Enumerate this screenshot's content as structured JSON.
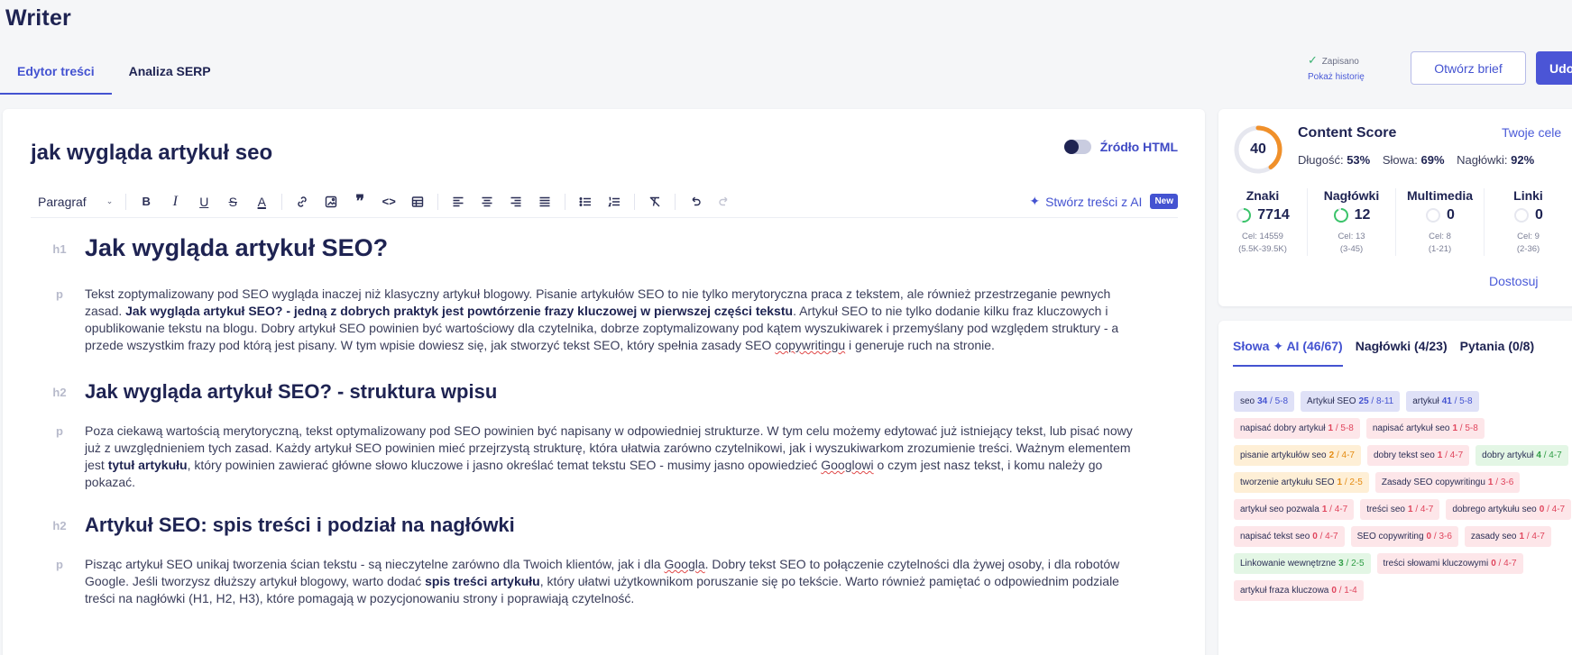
{
  "app": {
    "title": "Writer"
  },
  "tabs": [
    {
      "label": "Edytor treści",
      "active": true
    },
    {
      "label": "Analiza SERP",
      "active": false
    }
  ],
  "header": {
    "saved_label": "Zapisano",
    "history_label": "Pokaż historię",
    "brief_button": "Otwórz brief",
    "share_button": "Udostępnij"
  },
  "editor": {
    "title": "jak wygląda artykuł seo",
    "html_source_label": "Źródło HTML",
    "html_source_enabled": false,
    "toolbar": {
      "paragraph_select": "Paragraf",
      "ai_button": "Stwórz treści z AI",
      "ai_badge": "New"
    },
    "blocks": [
      {
        "tag": "h1",
        "text": "Jak wygląda artykuł SEO?"
      },
      {
        "tag": "p",
        "parts": [
          "Tekst zoptymalizowany pod SEO wygląda inaczej niż klasyczny artykuł blogowy. Pisanie artykułów SEO to nie tylko merytoryczna praca z tekstem, ale również przestrzeganie pewnych zasad. ",
          "Jak wygląda artykuł SEO? - jedną z dobrych praktyk jest powtórzenie frazy kluczowej w pierwszej części tekstu",
          ". Artykuł SEO to nie tylko dodanie kilku fraz kluczowych i opublikowanie tekstu na blogu. Dobry artykuł SEO powinien być wartościowy dla czytelnika, dobrze zoptymalizowany pod kątem wyszukiwarek i przemyślany pod względem struktury - a przede wszystkim frazy pod którą jest pisany. W tym wpisie dowiesz się, jak stworzyć tekst SEO, który spełnia zasady SEO ",
          "copywritingu",
          " i generuje ruch na stronie."
        ]
      },
      {
        "tag": "h2",
        "text": "Jak wygląda artykuł SEO? - struktura wpisu"
      },
      {
        "tag": "p",
        "parts": [
          "Poza ciekawą wartością merytoryczną, tekst optymalizowany pod SEO powinien być napisany w odpowiedniej strukturze. W tym celu możemy edytować już istniejący tekst, lub pisać nowy już z uwzględnieniem tych zasad. Każdy artykuł SEO powinien mieć przejrzystą strukturę, która ułatwia zarówno czytelnikowi, jak i wyszukiwarkom zrozumienie treści. Ważnym elementem jest ",
          "tytuł artykułu",
          ", który powinien zawierać główne słowo kluczowe i jasno określać temat tekstu SEO - musimy jasno opowiedzieć ",
          "Googlowi",
          " o czym jest nasz tekst, i komu należy go pokazać."
        ]
      },
      {
        "tag": "h2",
        "text": "Artykuł SEO: spis treści i podział na nagłówki"
      },
      {
        "tag": "p",
        "parts": [
          "Pisząc artykuł SEO unikaj tworzenia ścian tekstu - są nieczytelne zarówno dla Twoich klientów, jak i dla ",
          "Googla",
          ". Dobry tekst SEO to połączenie czytelności dla żywej osoby, i dla robotów Google. Jeśli tworzysz dłuższy artykuł blogowy, warto dodać ",
          "spis treści artykułu",
          ", który ułatwi użytkownikom poruszanie się po tekście. Warto również pamiętać o odpowiednim podziale treści na nagłówki (H1, H2, H3), które pomagają w pozycjonowaniu strony i poprawiają czytelność."
        ]
      }
    ]
  },
  "content_score": {
    "score": "40",
    "score_value": 40,
    "title": "Content Score",
    "goals_link": "Twoje cele",
    "metrics": [
      {
        "label": "Długość:",
        "value": "53%"
      },
      {
        "label": "Słowa:",
        "value": "69%"
      },
      {
        "label": "Nagłówki:",
        "value": "92%"
      }
    ],
    "stats": [
      {
        "label": "Znaki",
        "value": "7714",
        "goal": "Cel: 14559",
        "range": "(5.5K-39.5K)",
        "progress": 0.53
      },
      {
        "label": "Nagłówki",
        "value": "12",
        "goal": "Cel: 13",
        "range": "(3-45)",
        "progress": 0.92
      },
      {
        "label": "Multimedia",
        "value": "0",
        "goal": "Cel: 8",
        "range": "(1-21)",
        "progress": 0
      },
      {
        "label": "Linki",
        "value": "0",
        "goal": "Cel: 9",
        "range": "(2-36)",
        "progress": 0
      }
    ],
    "adjust_link": "Dostosuj",
    "colors": {
      "score": "#f0902a",
      "progress": "#3bc46a",
      "track": "#e6e7ef"
    }
  },
  "keywords": {
    "tabs": [
      {
        "label": "Słowa ✦ AI  (46/67)",
        "active": true
      },
      {
        "label": "Nagłówki (4/23)",
        "active": false
      },
      {
        "label": "Pytania (0/8)",
        "active": false
      }
    ],
    "chips": [
      {
        "text": "seo",
        "count": "34",
        "range": "/ 5-8",
        "status": "blue"
      },
      {
        "text": "Artykuł SEO",
        "count": "25",
        "range": "/ 8-11",
        "status": "blue"
      },
      {
        "text": "artykuł",
        "count": "41",
        "range": "/ 5-8",
        "status": "blue"
      },
      {
        "text": "napisać dobry artykuł",
        "count": "1",
        "range": "/ 5-8",
        "status": "red"
      },
      {
        "text": "napisać artykuł seo",
        "count": "1",
        "range": "/ 5-8",
        "status": "red"
      },
      {
        "text": "pisanie artykułów seo",
        "count": "2",
        "range": "/ 4-7",
        "status": "orange"
      },
      {
        "text": "dobry tekst seo",
        "count": "1",
        "range": "/ 4-7",
        "status": "red"
      },
      {
        "text": "dobry artykuł",
        "count": "4",
        "range": "/ 4-7",
        "status": "green"
      },
      {
        "text": "tworzenie artykułu SEO",
        "count": "1",
        "range": "/ 2-5",
        "status": "orange"
      },
      {
        "text": "Zasady SEO copywritingu",
        "count": "1",
        "range": "/ 3-6",
        "status": "red"
      },
      {
        "text": "artykuł seo pozwala",
        "count": "1",
        "range": "/ 4-7",
        "status": "red"
      },
      {
        "text": "treści seo",
        "count": "1",
        "range": "/ 4-7",
        "status": "red"
      },
      {
        "text": "dobrego artykułu seo",
        "count": "0",
        "range": "/ 4-7",
        "status": "red"
      },
      {
        "text": "napisać tekst seo",
        "count": "0",
        "range": "/ 4-7",
        "status": "red"
      },
      {
        "text": "SEO copywriting",
        "count": "0",
        "range": "/ 3-6",
        "status": "red"
      },
      {
        "text": "zasady seo",
        "count": "1",
        "range": "/ 4-7",
        "status": "red"
      },
      {
        "text": "Linkowanie wewnętrzne",
        "count": "3",
        "range": "/ 2-5",
        "status": "green"
      },
      {
        "text": "treści słowami kluczowymi",
        "count": "0",
        "range": "/ 4-7",
        "status": "red"
      },
      {
        "text": "artykuł fraza kluczowa",
        "count": "0",
        "range": "/ 1-4",
        "status": "red"
      }
    ]
  }
}
